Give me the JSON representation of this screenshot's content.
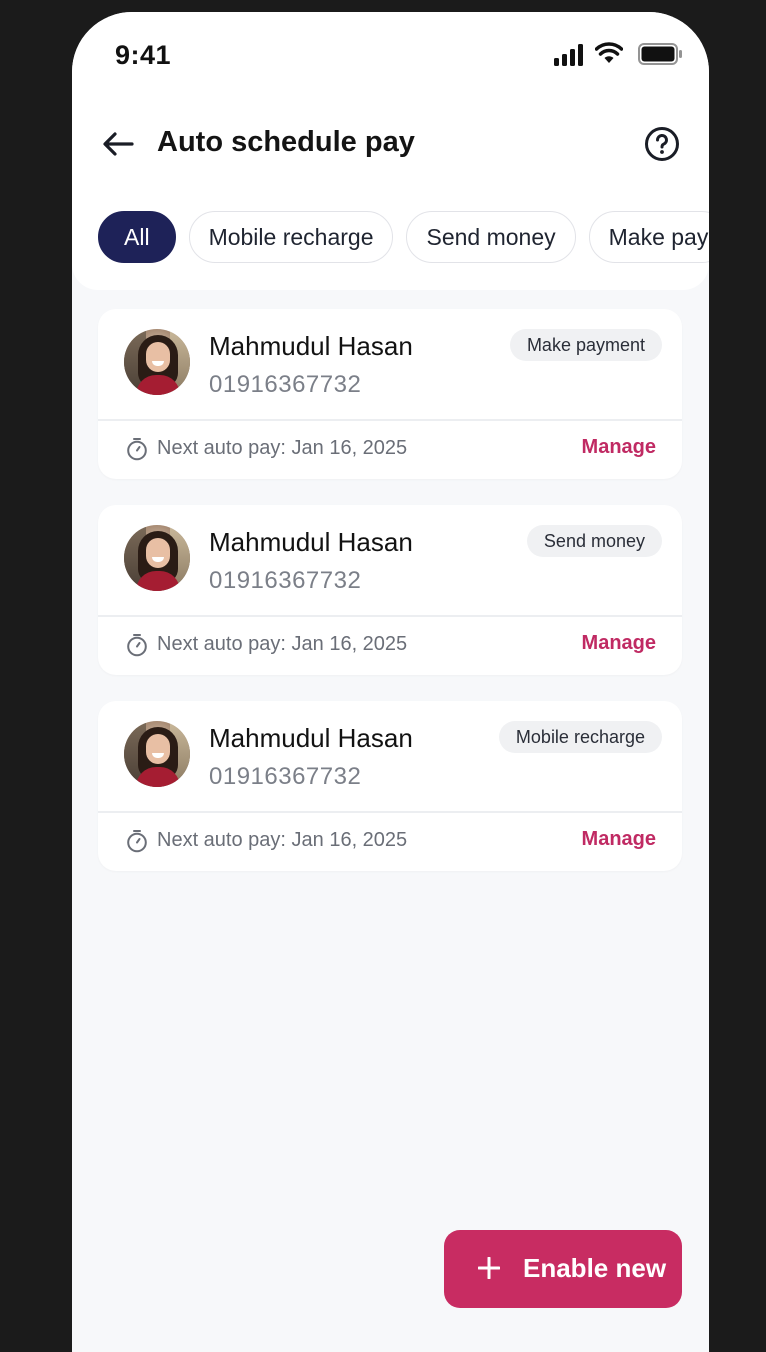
{
  "status_bar": {
    "time": "9:41"
  },
  "header": {
    "title": "Auto schedule pay"
  },
  "filters": [
    "All",
    "Mobile recharge",
    "Send money",
    "Make pay"
  ],
  "cards": [
    {
      "name": "Mahmudul Hasan",
      "phone": "01916367732",
      "type": "Make payment",
      "next_pay": "Next auto pay: Jan 16, 2025",
      "action": "Manage"
    },
    {
      "name": "Mahmudul Hasan",
      "phone": "01916367732",
      "type": "Send money",
      "next_pay": "Next auto pay: Jan 16, 2025",
      "action": "Manage"
    },
    {
      "name": "Mahmudul Hasan",
      "phone": "01916367732",
      "type": "Mobile recharge",
      "next_pay": "Next auto pay: Jan 16, 2025",
      "action": "Manage"
    }
  ],
  "fab": {
    "label": "Enable new"
  },
  "colors": {
    "primary": "#1e2258",
    "accent": "#c82c62",
    "background": "#f7f8fa"
  }
}
